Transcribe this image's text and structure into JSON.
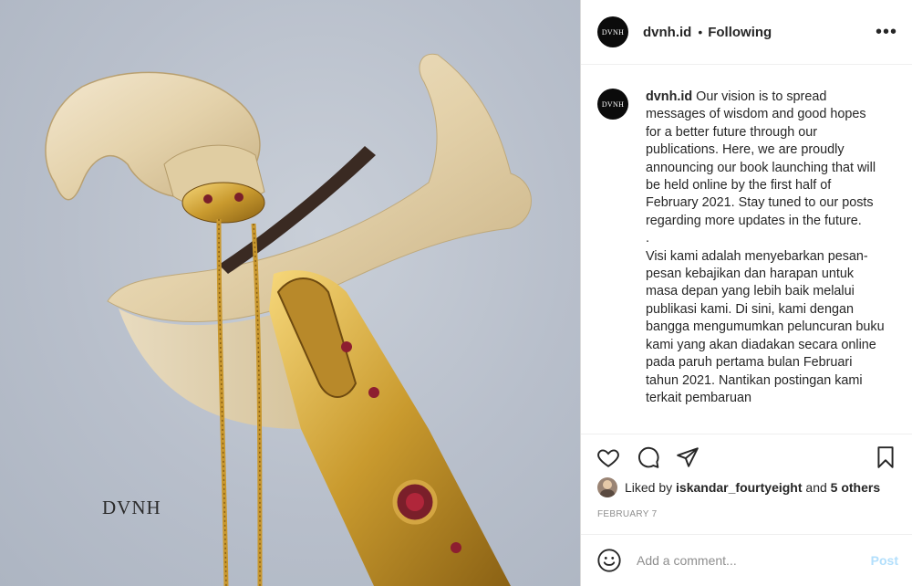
{
  "post": {
    "watermark": "DVNH"
  },
  "header": {
    "avatar_text": "DVNH",
    "username": "dvnh.id",
    "separator": "•",
    "follow_label": "Following",
    "more_icon": "more-horizontal-icon"
  },
  "caption": {
    "avatar_text": "DVNH",
    "username": "dvnh.id",
    "text": " Our vision is to spread messages of wisdom and good hopes for a better future through our publications. Here, we are proudly announcing our book launching that will be held online by the first half of February 2021. Stay tuned to our posts regarding more updates in the future.\n.\nVisi kami adalah menyebarkan pesan-pesan kebajikan dan harapan untuk masa depan yang lebih baik melalui publikasi kami. Di sini, kami dengan bangga mengumumkan peluncuran buku kami yang akan diadakan secara online pada paruh pertama bulan Februari tahun 2021. Nantikan postingan kami terkait pembaruan"
  },
  "actions": {
    "like_icon": "heart-icon",
    "comment_icon": "comment-icon",
    "share_icon": "send-icon",
    "save_icon": "bookmark-icon"
  },
  "likes": {
    "prefix": "Liked by ",
    "user": "iskandar_fourtyeight",
    "middle": " and ",
    "others": "5 others"
  },
  "date": "FEBRUARY 7",
  "comment": {
    "emoji_icon": "smiley-icon",
    "placeholder": "Add a comment...",
    "post_label": "Post"
  }
}
